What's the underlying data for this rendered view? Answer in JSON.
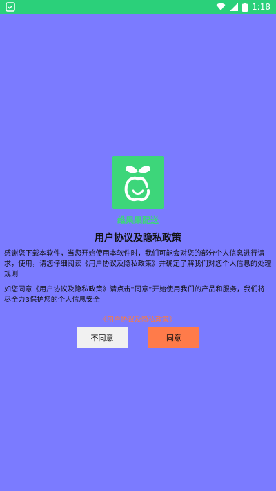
{
  "status_bar": {
    "time": "1:18",
    "icons": [
      "app-notification-icon",
      "wifi-icon",
      "signal-icon",
      "battery-icon"
    ]
  },
  "app": {
    "name": "维果果配送",
    "logo_icon": "apple-icon"
  },
  "dialog": {
    "title": "用户协议及隐私政策",
    "paragraph1": "感谢您下载本软件，当您开始使用本软件时，我们可能会对您的部分个人信息进行请求，使用，请您仔细阅读《用户协议及隐私政策》并确定了解我们对您个人信息的处理规则",
    "paragraph2": "如您同意《用户协议及隐私政策》请点击“同意”开始使用我们的产品和服务，我们将尽全力3保护您的个人信息安全",
    "policy_link": "《用户协议及隐私政策》",
    "disagree_label": "不同意",
    "agree_label": "同意"
  },
  "colors": {
    "background": "#7b7bff",
    "status_bar": "#2bd07a",
    "brand_green": "#3dd67a",
    "link_orange": "#ff7b3a",
    "agree_button": "#ff7b4a"
  }
}
